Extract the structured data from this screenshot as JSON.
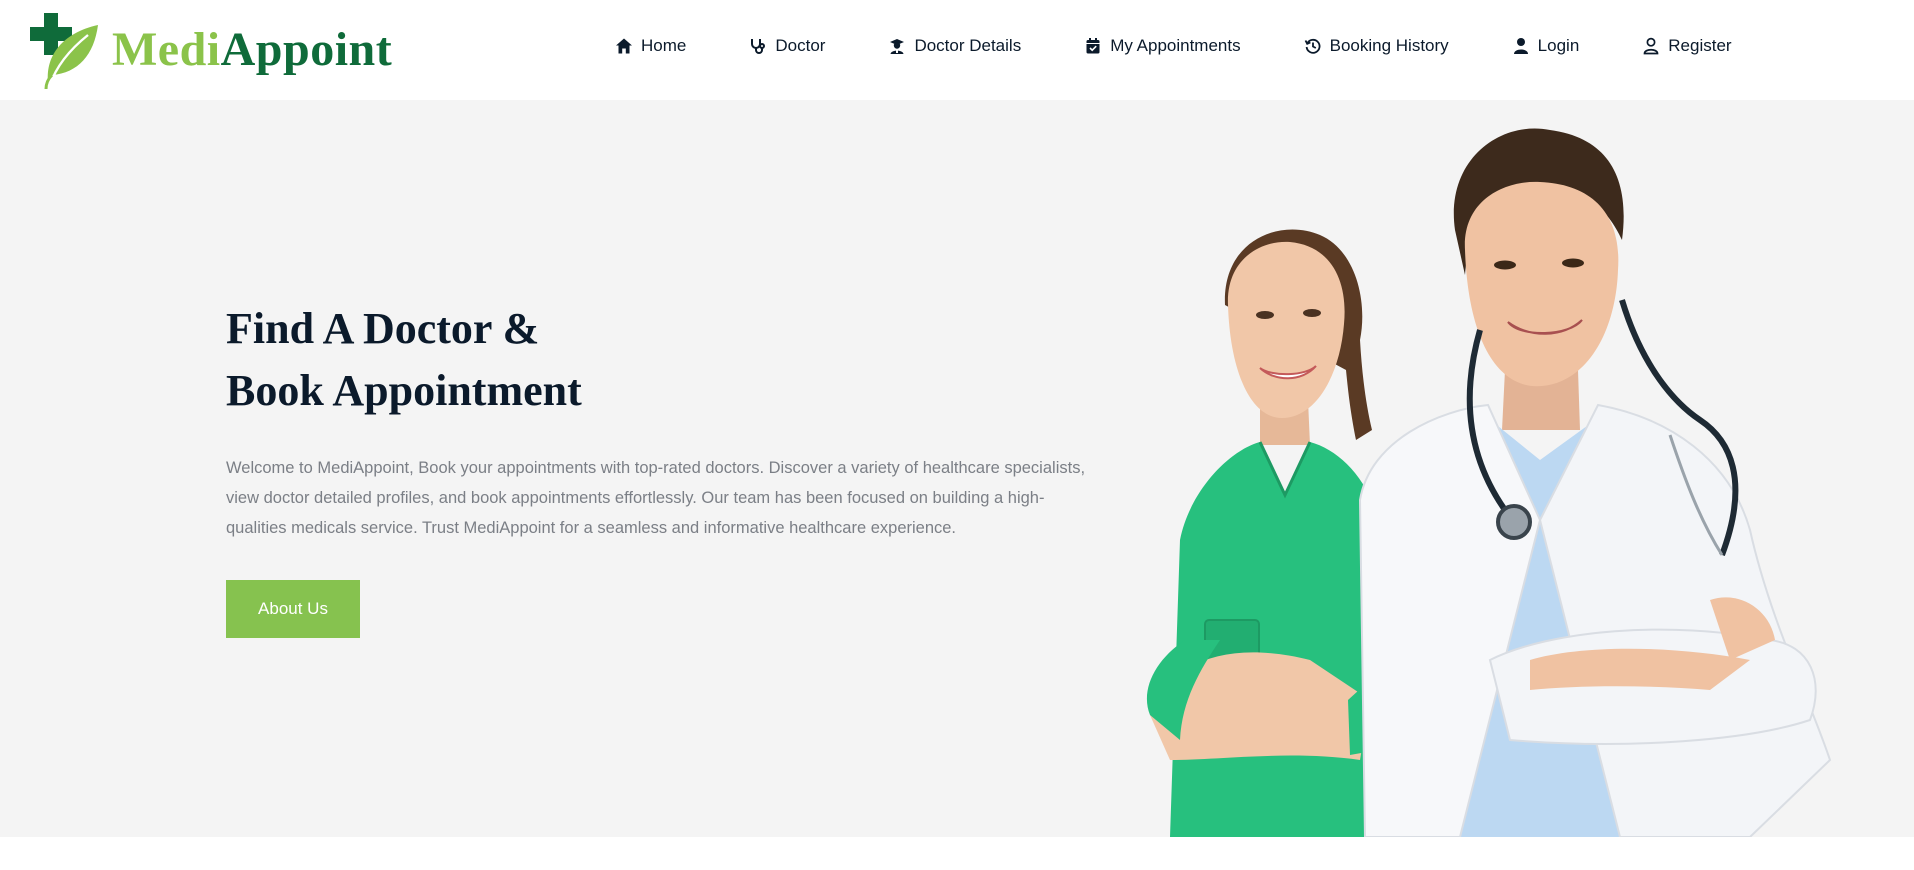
{
  "brand": {
    "name_part1": "Medi",
    "name_part2": "Appoint",
    "color_light_green": "#8bc34a",
    "color_dark_green": "#0f6b3a"
  },
  "nav": {
    "items": [
      {
        "label": "Home",
        "icon": "home-icon"
      },
      {
        "label": "Doctor",
        "icon": "stethoscope-icon"
      },
      {
        "label": "Doctor Details",
        "icon": "doctor-icon"
      },
      {
        "label": "My Appointments",
        "icon": "calendar-check-icon"
      },
      {
        "label": "Booking History",
        "icon": "history-icon"
      },
      {
        "label": "Login",
        "icon": "user-solid-icon"
      },
      {
        "label": "Register",
        "icon": "user-outline-icon"
      }
    ]
  },
  "hero": {
    "title_line1": "Find A Doctor &",
    "title_line2": "Book Appointment",
    "description": "Welcome to MediAppoint, Book your appointments with top-rated doctors. Discover a variety of healthcare specialists, view doctor detailed profiles, and book appointments effortlessly. Our team has been focused on building a high-qualities medicals service. Trust MediAppoint for a seamless and informative healthcare experience.",
    "button_label": "About Us",
    "accent_color": "#86c24f",
    "background": "#f4f4f4"
  }
}
